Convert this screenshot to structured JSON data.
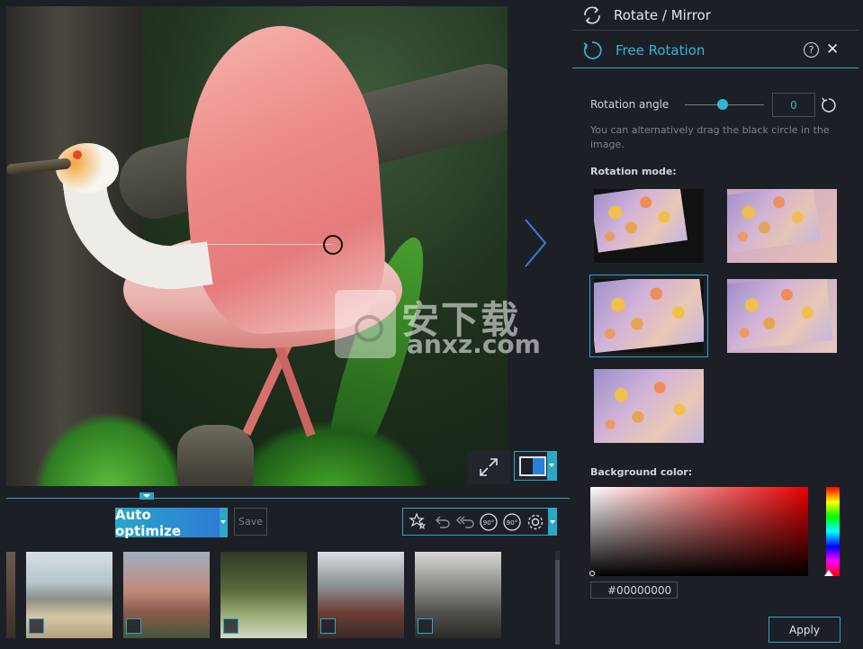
{
  "panel": {
    "rotate_mirror_title": "Rotate / Mirror",
    "free_rotation_title": "Free Rotation",
    "help_symbol": "?",
    "close_symbol": "✕",
    "rotation_angle_label": "Rotation angle",
    "rotation_angle_value": "0",
    "hint_text": "You can alternatively drag the black circle in the image.",
    "rotation_mode_label": "Rotation mode:",
    "background_color_label": "Background color:",
    "background_color_hex": "#00000000",
    "apply_label": "Apply"
  },
  "toolbar": {
    "auto_optimize_label": "Auto optimize",
    "save_label": "Save"
  },
  "watermark": {
    "cn": "安下载",
    "en": "anxz.com"
  },
  "icons": {
    "rotate_mirror": "rotate-mirror-icon",
    "free_rotation": "free-rotation-icon",
    "help": "help-icon",
    "close": "close-icon",
    "reset": "reset-rotation-icon",
    "next": "next-arrow-icon",
    "fullscreen": "fullscreen-icon",
    "compare": "before-after-compare-icon",
    "magic": "magic-wand-icon",
    "undo": "undo-icon",
    "undo_all": "undo-all-icon",
    "rotate_left": "rotate-left-90-icon",
    "rotate_right": "rotate-right-90-icon",
    "settings": "gear-icon"
  },
  "colors": {
    "accent": "#2aa8c5",
    "accent_text": "#2fb6d6",
    "panel_bg": "#1d1f26"
  },
  "thumbnails": [
    "partial",
    "beach",
    "cathedral",
    "hoopoe bird",
    "bridge",
    "machinery"
  ]
}
